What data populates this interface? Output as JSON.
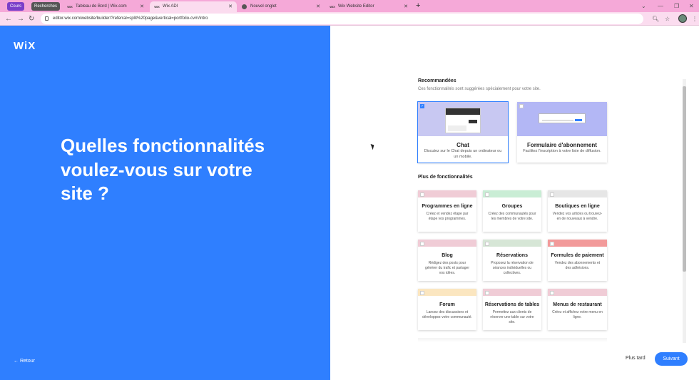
{
  "browser": {
    "tab_groups": [
      {
        "label": "Cours",
        "color": "#7b3fc9"
      },
      {
        "label": "Recherches",
        "color": "#555555"
      }
    ],
    "tabs": [
      {
        "favicon": "WIX",
        "title": "Tableau de Bord | Wix.com"
      },
      {
        "favicon": "WIX",
        "title": "Wix ADI"
      },
      {
        "favicon": "globe-icon",
        "title": "Nouvel onglet"
      },
      {
        "favicon": "WIX",
        "title": "Wix Website Editor"
      }
    ],
    "url": "editor.wix.com/website/builder/?referral=split%20page&vertical=portfolio-cv#!/intro"
  },
  "left": {
    "logo": "WiX",
    "question": "Quelles fonctionnalités voulez-vous sur votre site ?",
    "back_label": "← Retour"
  },
  "right": {
    "recommended_title": "Recommandées",
    "recommended_sub": "Ces fonctionnalités sont suggérées spécialement pour votre site.",
    "recommended": [
      {
        "title": "Chat",
        "desc": "Discutez sur le Chat depuis un ordinateur ou un mobile.",
        "checked": true,
        "color": "#c8c8f2"
      },
      {
        "title": "Formulaire d'abonnement",
        "desc": "Facilitez l'inscription à votre liste de diffusion.",
        "checked": false,
        "color": "#b3b7f5"
      }
    ],
    "more_title": "Plus de fonctionnalités",
    "features": [
      {
        "title": "Programmes en ligne",
        "desc": "Créez et vendez étape par étape vos programmes.",
        "color": "#f0ccd6"
      },
      {
        "title": "Groupes",
        "desc": "Créez des communautés pour les membres de votre site.",
        "color": "#c9edd5"
      },
      {
        "title": "Boutiques en ligne",
        "desc": "Vendez vos articles ou trouvez-en de nouveaux à vendre.",
        "color": "#e6e6e6"
      },
      {
        "title": "Blog",
        "desc": "Rédigez des posts pour générer du trafic et partager vos idées.",
        "color": "#f0ccd6"
      },
      {
        "title": "Réservations",
        "desc": "Proposez la réservation de séances individuelles ou collectives.",
        "color": "#d6e6d6"
      },
      {
        "title": "Formules de paiement",
        "desc": "Vendez des abonnements et des adhésions.",
        "color": "#f29a9a"
      },
      {
        "title": "Forum",
        "desc": "Lancez des discussions et développez votre communauté.",
        "color": "#fbe6c0"
      },
      {
        "title": "Réservations de tables",
        "desc": "Permettez aux clients de réserver une table sur votre site.",
        "color": "#f0ccd6"
      },
      {
        "title": "Menus de restaurant",
        "desc": "Créez et affichez votre menu en ligne.",
        "color": "#f0ccd6"
      }
    ],
    "later_label": "Plus tard",
    "next_label": "Suivant"
  }
}
